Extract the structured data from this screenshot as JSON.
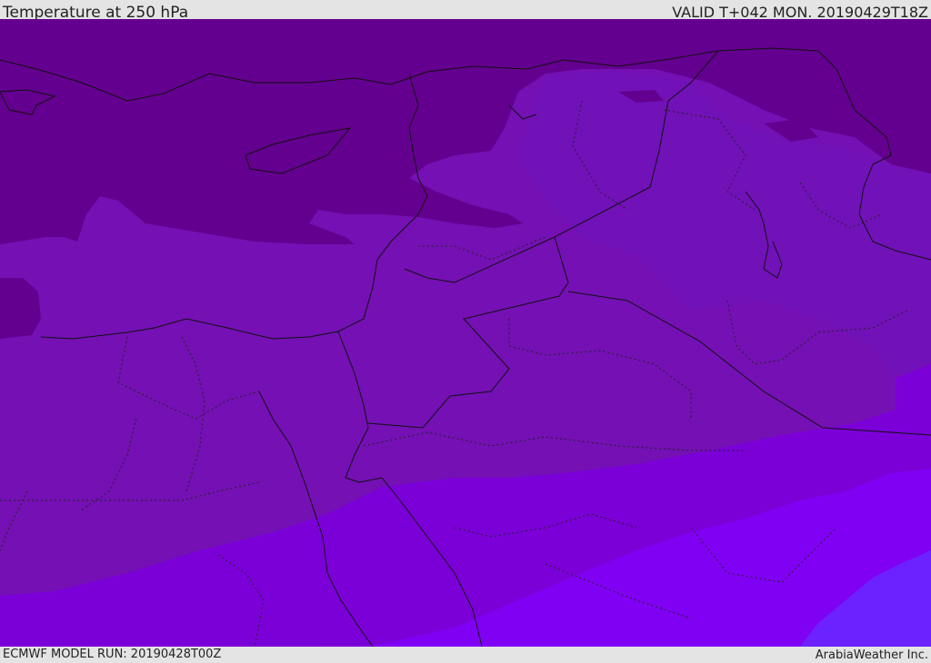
{
  "header": {
    "title": "Temperature at 250 hPa",
    "valid": "VALID T+042 MON. 20190429T18Z"
  },
  "footer": {
    "model_run": "ECMWF MODEL RUN: 20190428T00Z",
    "credit": "ArabiaWeather Inc."
  },
  "map": {
    "variable": "temperature",
    "level": "250 hPa",
    "colors": {
      "coldest": "#64008f",
      "cold": "#7410b4",
      "cool": "#6f12aa",
      "mid": "#7b00d8",
      "warm": "#8000f4",
      "warmest": "#6b22ff",
      "border": "#111111"
    }
  }
}
